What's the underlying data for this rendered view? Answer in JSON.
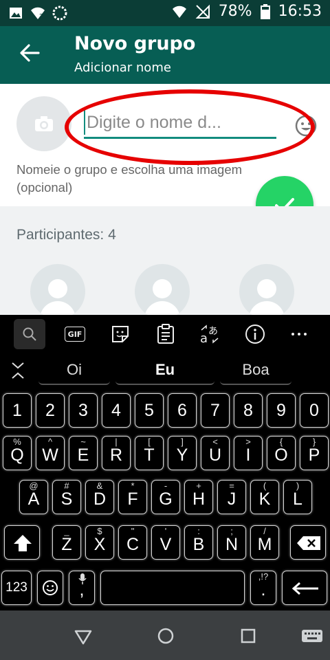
{
  "status_bar": {
    "battery_percent": "78%",
    "time": "16:53"
  },
  "app_bar": {
    "title": "Novo grupo",
    "subtitle": "Adicionar nome"
  },
  "name_field": {
    "placeholder": "Digite o nome d...",
    "value": ""
  },
  "hint_text": "Nomeie o grupo e escolha uma imagem (opcional)",
  "participants_label": "Participantes: 4",
  "keyboard": {
    "suggestions": [
      "Oi",
      "Eu",
      "Boa"
    ],
    "gif_label": "GIF",
    "numbers": [
      "1",
      "2",
      "3",
      "4",
      "5",
      "6",
      "7",
      "8",
      "9",
      "0"
    ],
    "row_q": [
      {
        "k": "Q",
        "s": "%"
      },
      {
        "k": "W",
        "s": "^"
      },
      {
        "k": "E",
        "s": "~"
      },
      {
        "k": "R",
        "s": "|"
      },
      {
        "k": "T",
        "s": "["
      },
      {
        "k": "Y",
        "s": "]"
      },
      {
        "k": "U",
        "s": "<"
      },
      {
        "k": "I",
        "s": ">"
      },
      {
        "k": "O",
        "s": "{"
      },
      {
        "k": "P",
        "s": "}"
      }
    ],
    "row_a": [
      {
        "k": "A",
        "s": "@"
      },
      {
        "k": "S",
        "s": "#"
      },
      {
        "k": "D",
        "s": "&"
      },
      {
        "k": "F",
        "s": "*"
      },
      {
        "k": "G",
        "s": "-"
      },
      {
        "k": "H",
        "s": "+"
      },
      {
        "k": "J",
        "s": "="
      },
      {
        "k": "K",
        "s": "("
      },
      {
        "k": "L",
        "s": ")"
      }
    ],
    "row_z": [
      {
        "k": "Z",
        "s": "_"
      },
      {
        "k": "X",
        "s": "$"
      },
      {
        "k": "C",
        "s": "\""
      },
      {
        "k": "V",
        "s": "'"
      },
      {
        "k": "B",
        "s": ":"
      },
      {
        "k": "N",
        "s": ";"
      },
      {
        "k": "M",
        "s": "/"
      }
    ],
    "symbols_key": "123",
    "comma_key": ",",
    "period_key": ".",
    "punct_sub": ",!?"
  },
  "colors": {
    "app_bar": "#075e54",
    "accent": "#128c7e",
    "fab": "#25d366",
    "annotation": "#e60000"
  }
}
